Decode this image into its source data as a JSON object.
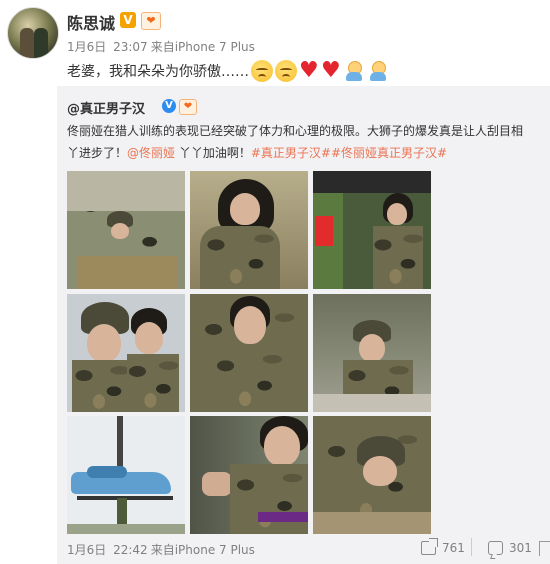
{
  "post": {
    "user_name": "陈思诚",
    "vip_badge": "V",
    "date": "1月6日",
    "time": "23:07",
    "source": "来自iPhone 7 Plus",
    "text": "老婆，我和朵朵为你骄傲……"
  },
  "repost": {
    "user_name": "@真正男子汉",
    "text_line1": "佟丽娅在猎人训练的表现已经突破了体力和心理的极限。大狮子的爆发真是让人刮目相",
    "text_line2_a": "丫进步了！",
    "mention": "@佟丽娅",
    "text_line2_b": " 丫丫加油啊！",
    "tags": "#真正男子汉##佟丽娅真正男子汉#",
    "date": "1月6日",
    "time": "22:42",
    "source": "来自iPhone 7 Plus",
    "shares": "761",
    "comments": "301"
  },
  "colors": {
    "link": "#eb7350",
    "card_bg": "#f2f2f5",
    "text": "#333333",
    "meta": "#808080"
  },
  "icons": [
    "vip-icon",
    "fan-heart-icon",
    "verified-icon",
    "share-icon",
    "comment-icon"
  ]
}
